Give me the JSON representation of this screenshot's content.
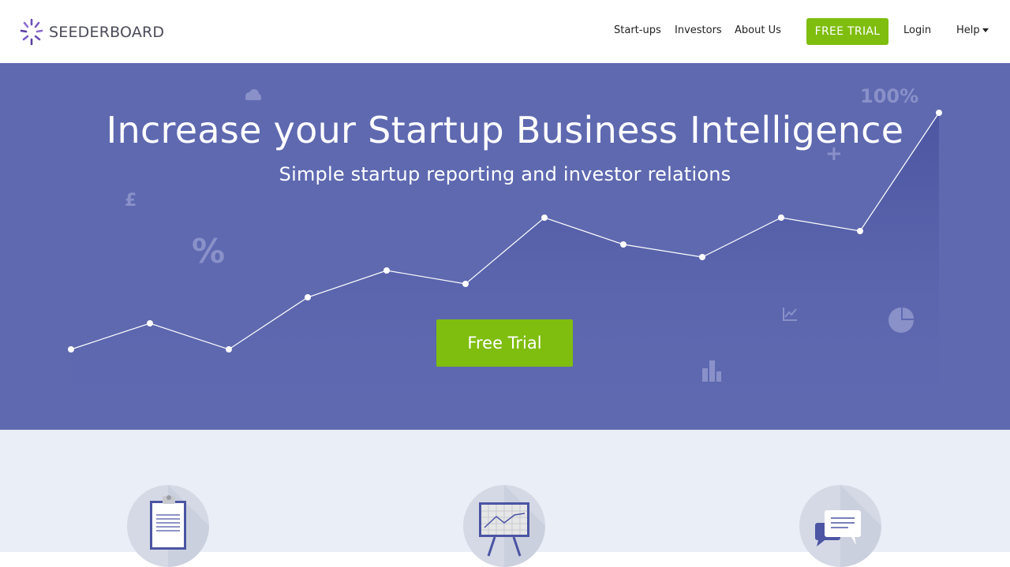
{
  "brand": {
    "name": "SEEDERBOARD"
  },
  "nav": {
    "startups": "Start-ups",
    "investors": "Investors",
    "about": "About Us",
    "free_trial": "FREE TRIAL",
    "login": "Login",
    "help": "Help"
  },
  "hero": {
    "title": "Increase your Startup Business Intelligence",
    "subtitle": "Simple startup reporting and investor relations",
    "cta": "Free Trial",
    "decor": {
      "percent_big": "100%",
      "percent": "%",
      "pound": "£",
      "plus": "+"
    }
  },
  "features": [
    {
      "icon": "clipboard-icon"
    },
    {
      "icon": "presentation-chart-icon"
    },
    {
      "icon": "chat-bubbles-icon"
    }
  ],
  "colors": {
    "brand_purple": "#5e69b0",
    "accent_green": "#7fbd0f",
    "features_bg": "#eaeef6"
  }
}
